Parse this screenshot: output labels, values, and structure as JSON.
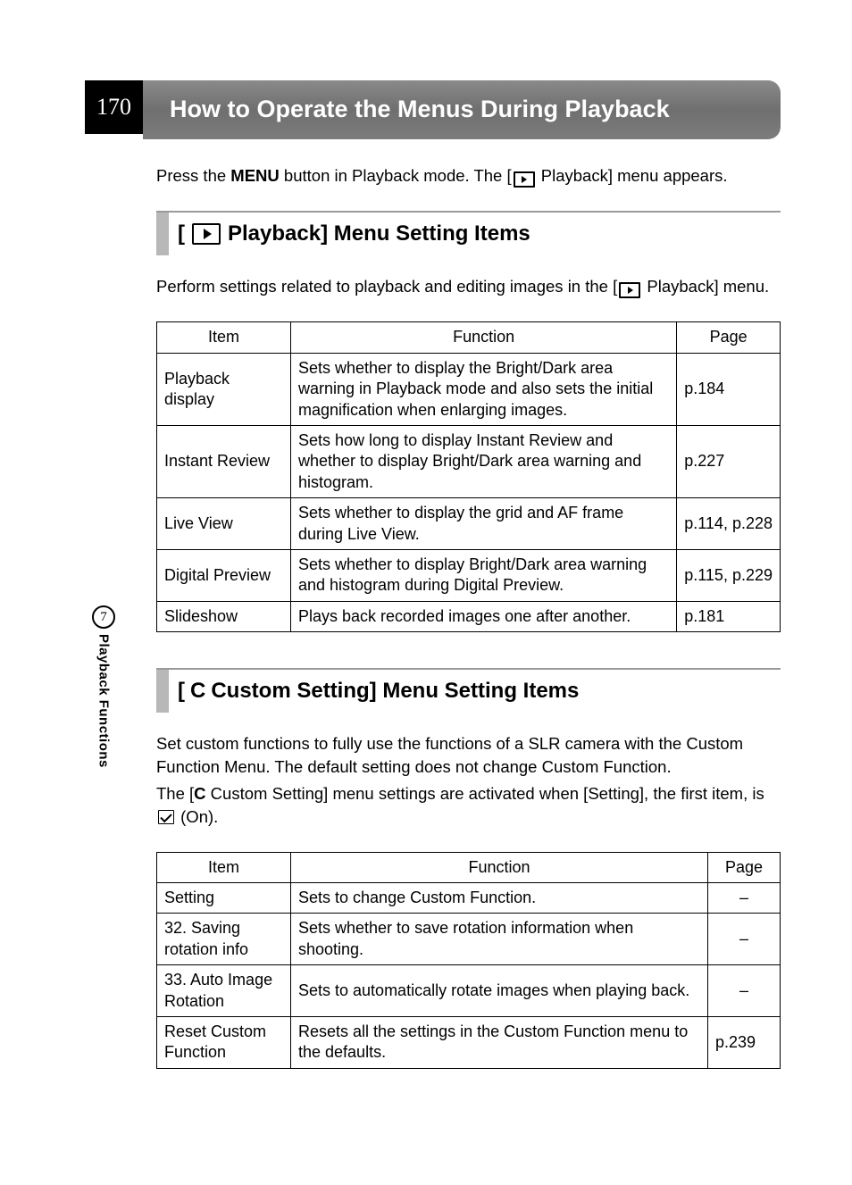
{
  "page_number": "170",
  "title": "How to Operate the Menus During Playback",
  "intro_prefix": "Press the ",
  "intro_menu": "MENU",
  "intro_mid": " button in Playback mode. The [",
  "intro_suffix": " Playback] menu appears.",
  "section1": {
    "heading_prefix": "[",
    "heading_suffix": " Playback] Menu Setting Items",
    "desc_prefix": "Perform settings related to playback and editing images in the [",
    "desc_suffix": " Playback] menu.",
    "headers": {
      "item": "Item",
      "function": "Function",
      "page": "Page"
    },
    "rows": [
      {
        "item": "Playback display",
        "func": "Sets whether to display the Bright/Dark area warning in Playback mode and also sets the initial magnification when enlarging images.",
        "page": "p.184"
      },
      {
        "item": "Instant Review",
        "func": "Sets how long to display Instant Review and whether to display Bright/Dark area warning and histogram.",
        "page": "p.227"
      },
      {
        "item": "Live View",
        "func": "Sets whether to display the grid and AF frame during Live View.",
        "page": "p.114, p.228"
      },
      {
        "item": "Digital Preview",
        "func": "Sets whether to display Bright/Dark area warning and histogram during Digital Preview.",
        "page": "p.115, p.229"
      },
      {
        "item": "Slideshow",
        "func": "Plays back recorded images one after another.",
        "page": "p.181"
      }
    ]
  },
  "section2": {
    "heading_prefix": "[",
    "heading_symbol": "C",
    "heading_suffix": " Custom Setting] Menu Setting Items",
    "desc_line1": "Set custom functions to fully use the functions of a SLR camera with the Custom Function Menu. The default setting does not change Custom Function.",
    "desc_line2_prefix": "The [",
    "desc_line2_symbol": "C",
    "desc_line2_mid": " Custom Setting] menu settings are activated when [Setting], the first item, is ",
    "desc_line2_suffix": " (On).",
    "headers": {
      "item": "Item",
      "function": "Function",
      "page": "Page"
    },
    "rows": [
      {
        "item": "Setting",
        "func": "Sets to change Custom Function.",
        "page": "–"
      },
      {
        "item": "32. Saving rotation info",
        "func": "Sets whether to save rotation information when shooting.",
        "page": "–"
      },
      {
        "item": "33. Auto Image Rotation",
        "func": "Sets to automatically rotate images when playing back.",
        "page": "–"
      },
      {
        "item": "Reset Custom Function",
        "func": "Resets all the settings in the Custom Function menu to the defaults.",
        "page": "p.239"
      }
    ]
  },
  "side": {
    "chapter": "7",
    "label": "Playback Functions"
  }
}
